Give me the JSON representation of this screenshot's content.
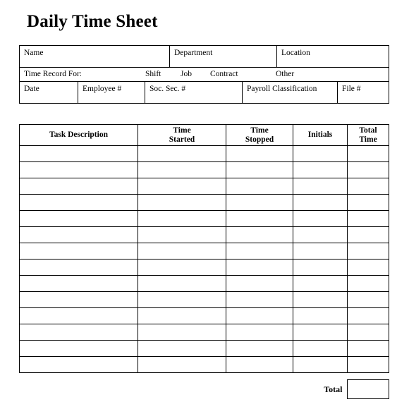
{
  "document": {
    "title": "Daily Time Sheet"
  },
  "info_table": {
    "row_name": {
      "name_label": "Name",
      "department_label": "Department",
      "location_label": "Location"
    },
    "row_time_record": {
      "record_for_label": "Time Record For:",
      "shift_label": "Shift",
      "job_label": "Job",
      "contract_label": "Contract",
      "other_label": "Other"
    },
    "row_ids": {
      "date_label": "Date",
      "employee_label": "Employee #",
      "ssn_label": "Soc. Sec. #",
      "payroll_label": "Payroll Classification",
      "file_label": "File #"
    }
  },
  "task_table": {
    "headers": [
      {
        "line1": "Task Description",
        "line2": ""
      },
      {
        "line1": "Time",
        "line2": "Started"
      },
      {
        "line1": "Time",
        "line2": "Stopped"
      },
      {
        "line1": "Initials",
        "line2": ""
      },
      {
        "line1": "Total",
        "line2": "Time"
      }
    ],
    "row_count": 14,
    "rows": [
      {
        "task": "",
        "time_started": "",
        "time_stopped": "",
        "initials": "",
        "total_time": ""
      },
      {
        "task": "",
        "time_started": "",
        "time_stopped": "",
        "initials": "",
        "total_time": ""
      },
      {
        "task": "",
        "time_started": "",
        "time_stopped": "",
        "initials": "",
        "total_time": ""
      },
      {
        "task": "",
        "time_started": "",
        "time_stopped": "",
        "initials": "",
        "total_time": ""
      },
      {
        "task": "",
        "time_started": "",
        "time_stopped": "",
        "initials": "",
        "total_time": ""
      },
      {
        "task": "",
        "time_started": "",
        "time_stopped": "",
        "initials": "",
        "total_time": ""
      },
      {
        "task": "",
        "time_started": "",
        "time_stopped": "",
        "initials": "",
        "total_time": ""
      },
      {
        "task": "",
        "time_started": "",
        "time_stopped": "",
        "initials": "",
        "total_time": ""
      },
      {
        "task": "",
        "time_started": "",
        "time_stopped": "",
        "initials": "",
        "total_time": ""
      },
      {
        "task": "",
        "time_started": "",
        "time_stopped": "",
        "initials": "",
        "total_time": ""
      },
      {
        "task": "",
        "time_started": "",
        "time_stopped": "",
        "initials": "",
        "total_time": ""
      },
      {
        "task": "",
        "time_started": "",
        "time_stopped": "",
        "initials": "",
        "total_time": ""
      },
      {
        "task": "",
        "time_started": "",
        "time_stopped": "",
        "initials": "",
        "total_time": ""
      },
      {
        "task": "",
        "time_started": "",
        "time_stopped": "",
        "initials": "",
        "total_time": ""
      }
    ]
  },
  "total_row": {
    "label": "Total",
    "value": ""
  },
  "colors": {
    "page_background": "#ffffff",
    "border": "#000000",
    "text": "#000000"
  }
}
